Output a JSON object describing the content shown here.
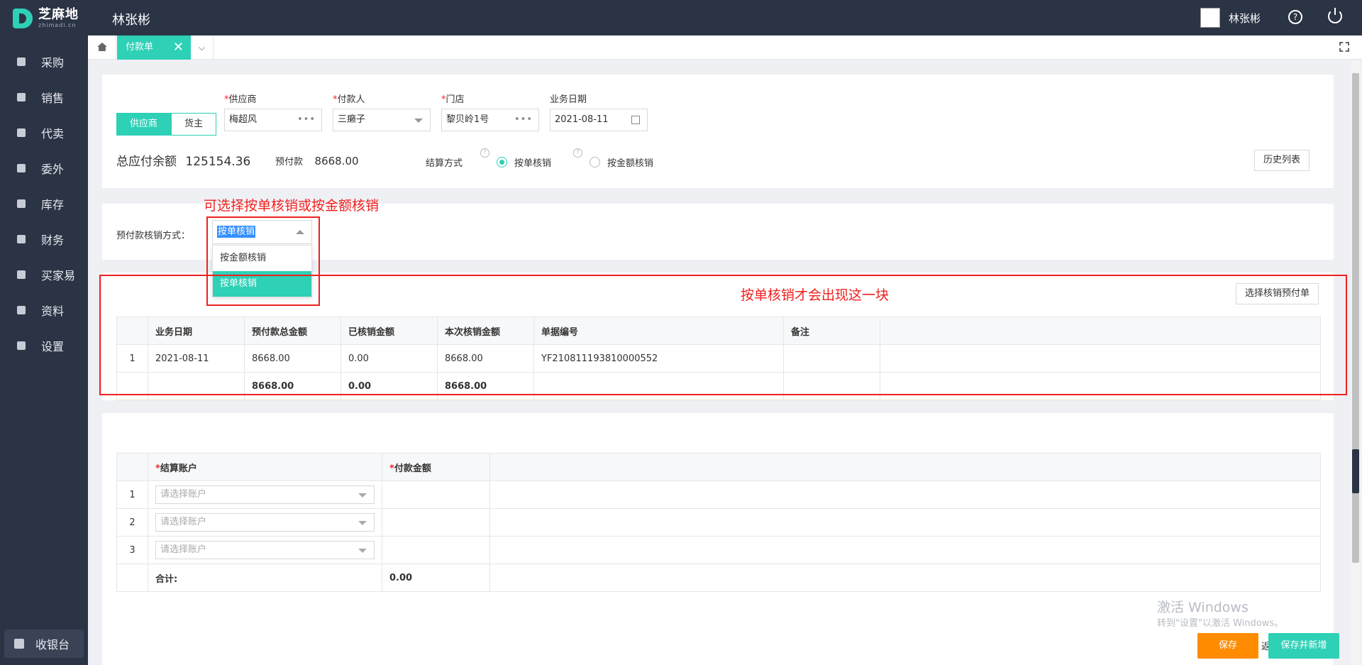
{
  "app": {
    "logo_cn": "芝麻地",
    "logo_en": "zhimadi.cn",
    "title": "林张彬",
    "user_name": "林张彬"
  },
  "sidebar": {
    "items": [
      {
        "label": "采购",
        "icon": "basket-icon"
      },
      {
        "label": "销售",
        "icon": "cart-icon"
      },
      {
        "label": "代卖",
        "icon": "tag-icon"
      },
      {
        "label": "委外",
        "icon": "building-icon"
      },
      {
        "label": "库存",
        "icon": "warehouse-icon"
      },
      {
        "label": "财务",
        "icon": "money-icon"
      },
      {
        "label": "买家易",
        "icon": "store-icon"
      },
      {
        "label": "资料",
        "icon": "printer-icon"
      },
      {
        "label": "设置",
        "icon": "gear-icon"
      }
    ],
    "cashier": "收银台"
  },
  "tabs": {
    "active": "付款单",
    "close": "✕",
    "dropdown": "⌵"
  },
  "form": {
    "seg_supplier": "供应商",
    "seg_owner": "货主",
    "supplier_label": "供应商",
    "supplier_value": "梅超风",
    "payer_label": "付款人",
    "payer_value": "三癞子",
    "store_label": "门店",
    "store_value": "黎贝岭1号",
    "date_label": "业务日期",
    "date_value": "2021-08-11",
    "dots": "•••",
    "total_label": "总应付余额",
    "total_value": "125154.36",
    "prepay_label": "预付款",
    "prepay_value": "8668.00",
    "settle_label": "结算方式",
    "settle_opt1": "按单核销",
    "settle_opt2": "按金额核销",
    "qmark": "?",
    "history_btn": "历史列表"
  },
  "prepay": {
    "label": "预付款核销方式：",
    "selected": "按单核销",
    "options": [
      "按金额核销",
      "按单核销"
    ],
    "annotation1": "可选择按单核销或按金额核销",
    "annotation2": "按单核销才会出现这一块",
    "select_btn": "选择核销预付单"
  },
  "prepay_table": {
    "headers": [
      "业务日期",
      "预付款总金额",
      "已核销金额",
      "本次核销金额",
      "单据编号",
      "备注"
    ],
    "rows": [
      {
        "no": "1",
        "date": "2021-08-11",
        "total": "8668.00",
        "used": "0.00",
        "this": "8668.00",
        "code": "YF210811193810000552",
        "note": ""
      }
    ],
    "sum": {
      "total": "8668.00",
      "used": "0.00",
      "this": "8668.00"
    }
  },
  "account_table": {
    "h_account": "结算账户",
    "h_amount": "付款金额",
    "placeholder": "请选择账户",
    "rows": [
      "1",
      "2",
      "3"
    ],
    "sum_label": "合计:",
    "sum_value": "0.00"
  },
  "footer": {
    "watermark1": "激活 Windows",
    "watermark2": "转到\"设置\"以激活 Windows。",
    "save": "保存",
    "save_new": "保存并新增",
    "partial": "返"
  },
  "colors": {
    "accent": "#2ed0b6",
    "sidebar_bg": "#2b3445",
    "annotation": "#f02020",
    "save": "#ff8c00"
  }
}
